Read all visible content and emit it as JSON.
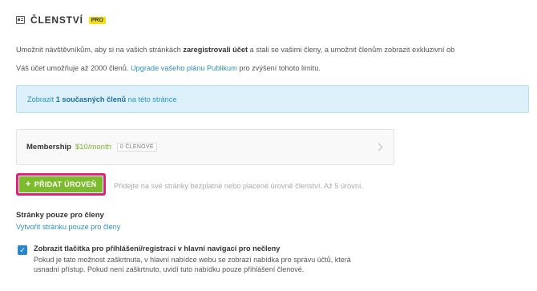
{
  "header": {
    "icon": "membership-card-icon",
    "title": "ČLENSTVÍ",
    "badge": "PRO"
  },
  "intro": {
    "before": "Umožnit návštěvníkům, aby si na vašich stránkách ",
    "bold": "zaregistrovali účet",
    "after": " a stali se vašimi členy, a umožnit členům zobrazit exkluzivní ob"
  },
  "limit": {
    "before": "Váš účet umožňuje až 2000 členů. ",
    "link": "Upgrade vašeho plánu Publikum",
    "after": " pro zvýšení tohoto limitu."
  },
  "info": {
    "before": "Zobrazit ",
    "bold": "1 současných členů",
    "after": " na této stránce"
  },
  "tier": {
    "name": "Membership",
    "price": "$10/month",
    "count": "0 ČLENOVÉ",
    "icon": "chevron-right-icon"
  },
  "add_tier": {
    "label": "PŘIDAT ÚROVEŇ",
    "icon": "plus-icon",
    "help": "Přidejte na své stránky bezplatné nebo placené úrovně členství. Až 5 úrovní."
  },
  "members_pages": {
    "title": "Stránky pouze pro členy",
    "link": "Vytvořit stránku pouze pro členy"
  },
  "nav_option": {
    "checked": true,
    "label": "Zobrazit tlačítka pro přihlášení/registraci v hlavní navigaci pro nečleny",
    "description": "Pokud je tato možnost zaškrtnuta, v hlavní nabídce webu se zobrazí nabídka pro správu účtů, která usnadní přístup. Pokud není zaškrtnuto, uvidí tuto nabídku pouze přihlášení členové."
  },
  "colors": {
    "accent_green": "#7dbb2e",
    "highlight_pink": "#e61f77",
    "link_blue": "#2a8fbd",
    "info_bg": "#dcf0f9",
    "pro_yellow": "#f4e10a"
  }
}
